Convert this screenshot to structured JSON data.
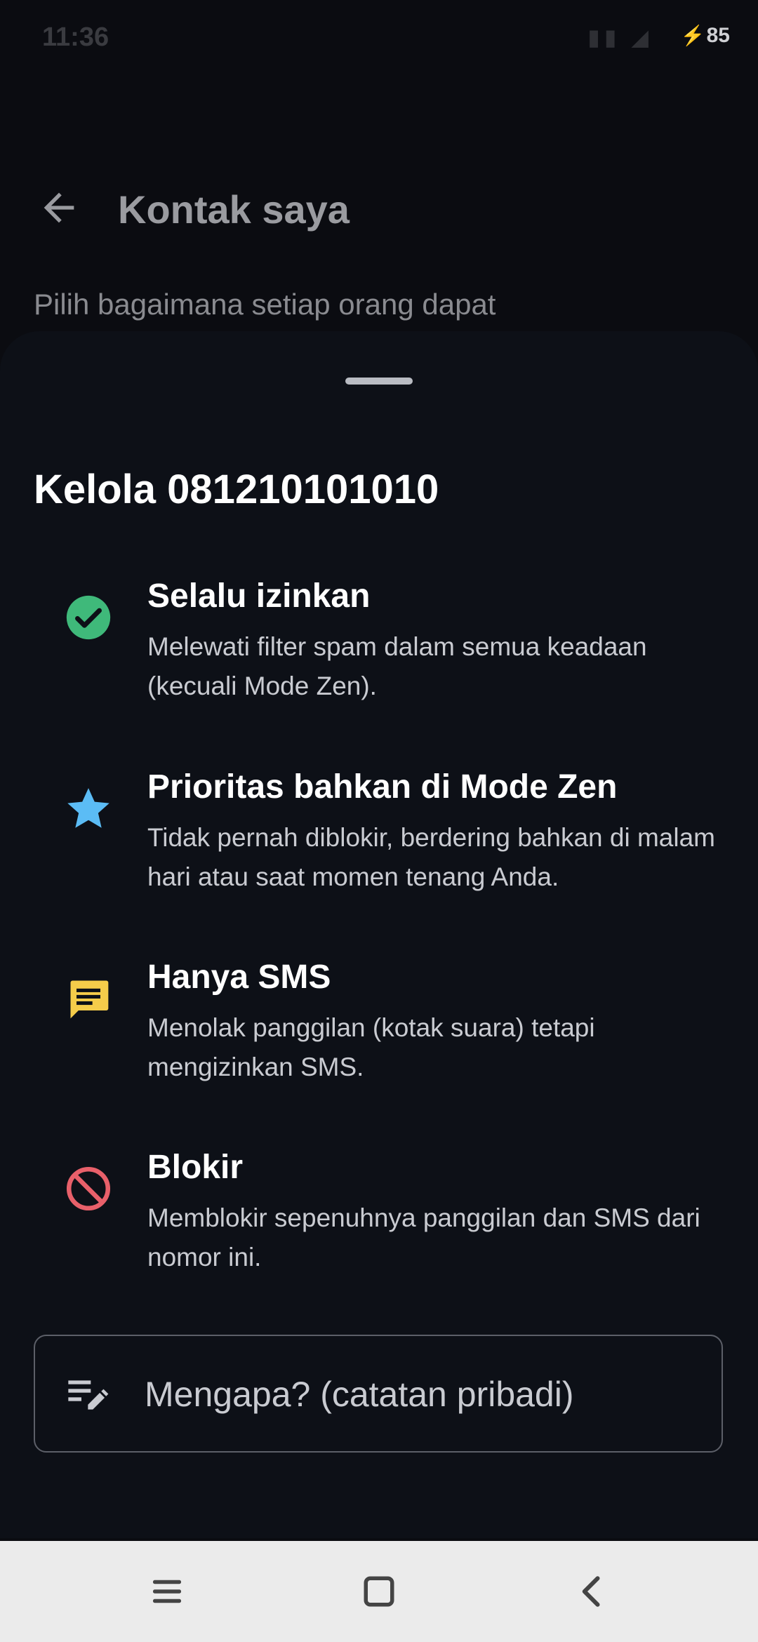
{
  "status_bar": {
    "time": "11:36",
    "battery": "85",
    "battery_icon": "charging-bolt-icon"
  },
  "background_page": {
    "title": "Kontak saya",
    "subtitle": "Pilih bagaimana setiap orang dapat"
  },
  "sheet": {
    "title": "Kelola 081210101010",
    "options": [
      {
        "title": "Selalu izinkan",
        "description": "Melewati filter spam dalam semua keadaan (kecuali Mode Zen).",
        "icon": "check-circle-icon",
        "color": "#3fb97a"
      },
      {
        "title": "Prioritas bahkan di Mode Zen",
        "description": "Tidak pernah diblokir, berdering bahkan di malam hari atau saat momen tenang Anda.",
        "icon": "star-icon",
        "color": "#5bbcf5"
      },
      {
        "title": "Hanya SMS",
        "description": "Menolak panggilan (kotak suara) tetapi mengizinkan SMS.",
        "icon": "message-icon",
        "color": "#f5cc4a"
      },
      {
        "title": "Blokir",
        "description": "Memblokir sepenuhnya panggilan dan SMS dari nomor ini.",
        "icon": "block-icon",
        "color": "#e8606a"
      }
    ],
    "note_field": {
      "placeholder": "Mengapa? (catatan pribadi)",
      "icon": "edit-note-icon"
    }
  },
  "nav_bar": {
    "buttons": [
      "menu-icon",
      "home-square-icon",
      "back-chevron-icon"
    ]
  }
}
